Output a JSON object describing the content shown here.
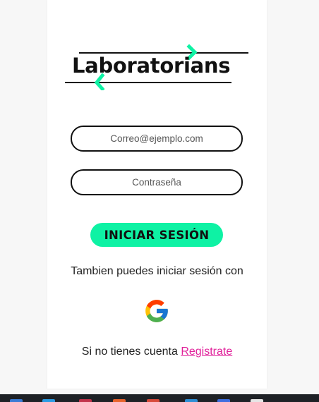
{
  "logo": {
    "text": "Laboratorians",
    "accent_color": "#0ef2a4"
  },
  "form": {
    "email": {
      "placeholder": "Correo@ejemplo.com",
      "value": ""
    },
    "password": {
      "placeholder": "Contraseña",
      "value": ""
    },
    "login_button_label": "INICIAR SESIÓN",
    "login_button_color": "#0ef2a4"
  },
  "alt_login": {
    "text": "Tambien puedes iniciar sesión con",
    "provider_icon": "google-icon"
  },
  "signup": {
    "prompt": "Si no tienes cuenta",
    "link_label": "Registrate",
    "link_color": "#e0219a"
  },
  "taskbar": {
    "icons": [
      "start-icon",
      "task-view-icon",
      "mail-icon",
      "firefox-icon",
      "chrome-icon",
      "vscode-icon",
      "app-icon",
      "app-icon-2"
    ]
  }
}
